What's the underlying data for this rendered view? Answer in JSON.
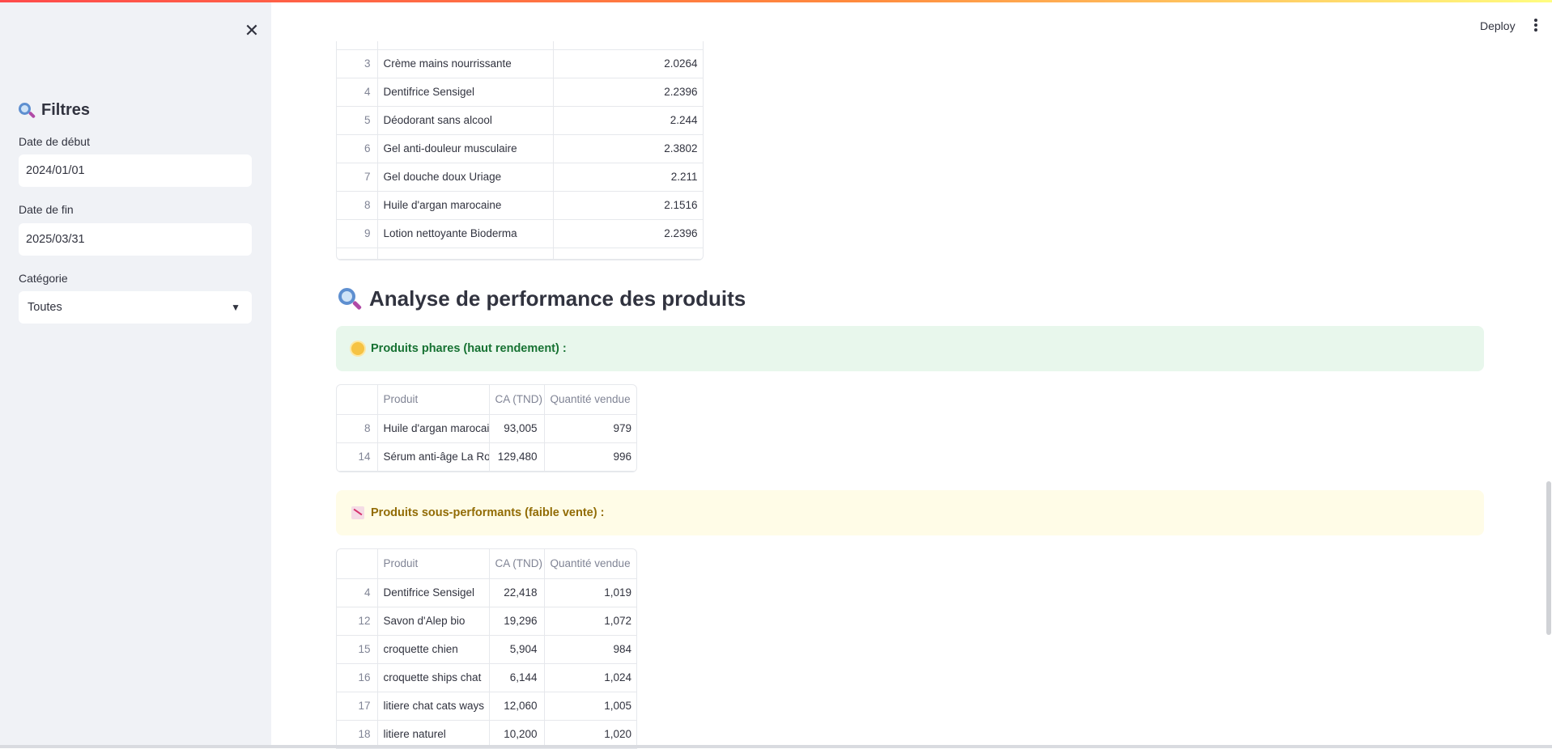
{
  "sidebar": {
    "title": "Filtres",
    "start_label": "Date de début",
    "start_value": "2024/01/01",
    "end_label": "Date de fin",
    "end_value": "2025/03/31",
    "category_label": "Catégorie",
    "category_value": "Toutes"
  },
  "header": {
    "deploy_label": "Deploy"
  },
  "top_table": {
    "rows": [
      {
        "idx": "3",
        "product": "Crème mains nourrissante",
        "value": "2.0264"
      },
      {
        "idx": "4",
        "product": "Dentifrice Sensigel",
        "value": "2.2396"
      },
      {
        "idx": "5",
        "product": "Déodorant sans alcool",
        "value": "2.244"
      },
      {
        "idx": "6",
        "product": "Gel anti-douleur musculaire",
        "value": "2.3802"
      },
      {
        "idx": "7",
        "product": "Gel douche doux Uriage",
        "value": "2.211"
      },
      {
        "idx": "8",
        "product": "Huile d'argan marocaine",
        "value": "2.1516"
      },
      {
        "idx": "9",
        "product": "Lotion nettoyante Bioderma",
        "value": "2.2396"
      }
    ]
  },
  "section_title": "Analyse de performance des produits",
  "top_alert": "Produits phares (haut rendement) :",
  "low_alert": "Produits sous-performants (faible vente) :",
  "columns": {
    "product": "Produit",
    "ca": "CA (TND)",
    "qty": "Quantité vendue"
  },
  "top_products": [
    {
      "idx": "8",
      "product": "Huile d'argan marocaine",
      "ca": "93,005",
      "qty": "979"
    },
    {
      "idx": "14",
      "product": "Sérum anti-âge La Roche-Posay",
      "ca": "129,480",
      "qty": "996"
    }
  ],
  "low_products": [
    {
      "idx": "4",
      "product": "Dentifrice Sensigel",
      "ca": "22,418",
      "qty": "1,019"
    },
    {
      "idx": "12",
      "product": "Savon d'Alep bio",
      "ca": "19,296",
      "qty": "1,072"
    },
    {
      "idx": "15",
      "product": "croquette chien",
      "ca": "5,904",
      "qty": "984"
    },
    {
      "idx": "16",
      "product": "croquette ships chat",
      "ca": "6,144",
      "qty": "1,024"
    },
    {
      "idx": "17",
      "product": "litiere chat cats ways",
      "ca": "12,060",
      "qty": "1,005"
    },
    {
      "idx": "18",
      "product": "litiere naturel",
      "ca": "10,200",
      "qty": "1,020"
    }
  ],
  "colors": {
    "accent": "#ff4b4b",
    "success_bg": "#e8f7ec",
    "warning_bg": "#fffce7"
  }
}
